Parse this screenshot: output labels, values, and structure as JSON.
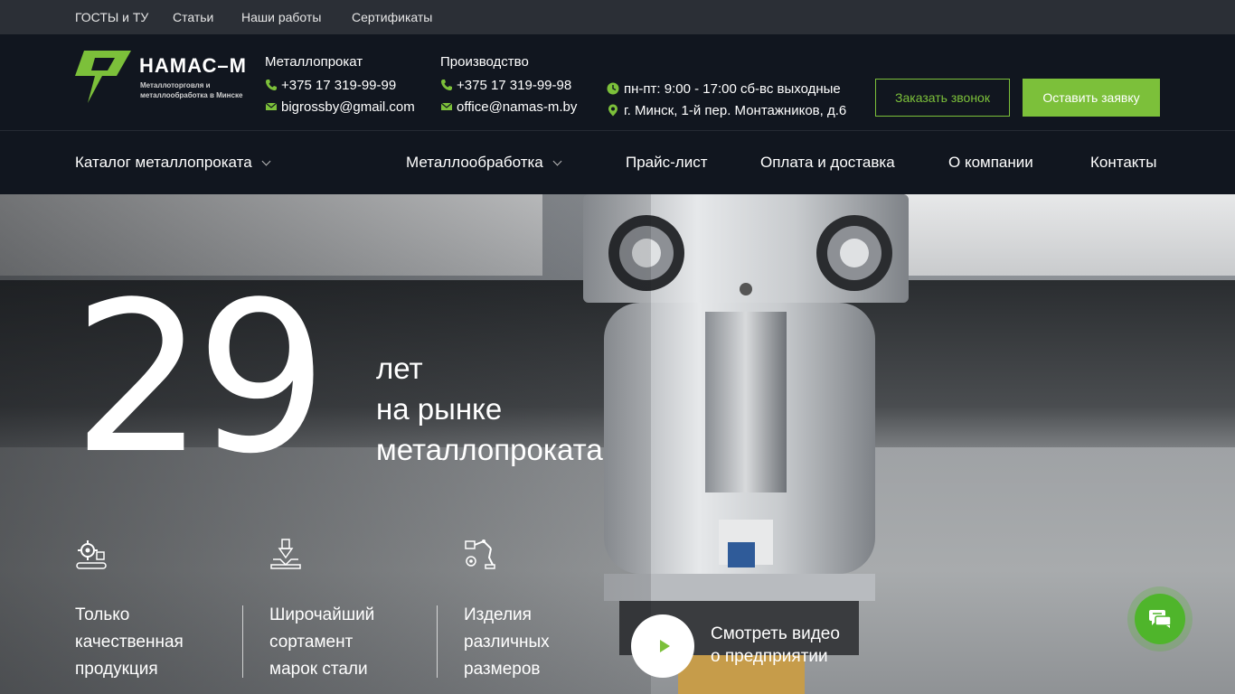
{
  "topbar": {
    "links": [
      "ГОСТЫ и ТУ",
      "Статьи",
      "Наши работы",
      "Сертификаты"
    ]
  },
  "header": {
    "logo_name": "НАМАС–М",
    "logo_tagline": "Металлоторговля и металлообработка в Минске",
    "contacts": [
      {
        "title": "Металлопрокат",
        "phone": "+375 17 319-99-99",
        "email": "bigrossby@gmail.com"
      },
      {
        "title": "Производство",
        "phone": "+375 17 319-99-98",
        "email": "office@namas-m.by"
      }
    ],
    "hours": "пн-пт: 9:00 - 17:00 сб-вс выходные",
    "address": "г. Минск, 1-й пер. Монтажников, д.6",
    "callback_label": "Заказать звонок",
    "request_label": "Оставить заявку"
  },
  "nav": {
    "items": [
      "Каталог металлопроката",
      "Металлообработка",
      "Прайс-лист",
      "Оплата и доставка",
      "О компании",
      "Контакты"
    ]
  },
  "hero": {
    "years": "29",
    "years_line1": "лет",
    "years_line2": "на рынке",
    "years_line3": "металлопроката",
    "features": [
      {
        "line1": "Только",
        "line2": "качественная",
        "line3": "продукция"
      },
      {
        "line1": "Широчайший",
        "line2": "сортамент",
        "line3": "марок стали"
      },
      {
        "line1": "Изделия",
        "line2": "различных",
        "line3": "размеров"
      }
    ],
    "video_line1": "Смотреть видео",
    "video_line2": "о предприятии"
  },
  "colors": {
    "accent": "#7cc03a",
    "header_bg": "#11161f",
    "topbar_bg": "#2b2f36",
    "chat": "#4fb52b"
  },
  "icons": [
    "logo-icon",
    "phone-icon",
    "mail-icon",
    "clock-icon",
    "location-pin-icon",
    "chevron-down-icon",
    "gear-conveyor-icon",
    "press-icon",
    "robot-arm-icon",
    "play-icon",
    "chat-icon"
  ]
}
